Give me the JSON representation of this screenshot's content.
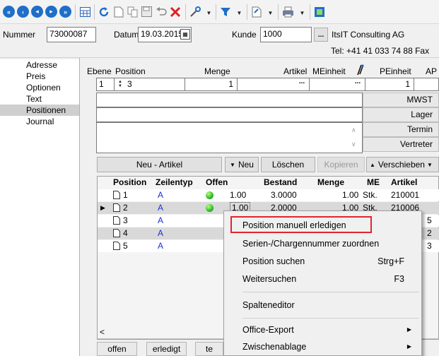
{
  "header": {
    "nummer_label": "Nummer",
    "nummer_value": "73000087",
    "datum_label": "Datum",
    "datum_value": "19.03.2015",
    "kunde_label": "Kunde",
    "kunde_value": "1000",
    "kunde_button": "...",
    "customer_name": "ItsIT Consulting AG",
    "tel": "Tel: +41 41 033 74 88  Fax"
  },
  "sidebar": {
    "items": [
      {
        "label": "Adresse"
      },
      {
        "label": "Preis"
      },
      {
        "label": "Optionen"
      },
      {
        "label": "Text"
      },
      {
        "label": "Positionen"
      },
      {
        "label": "Journal"
      }
    ]
  },
  "form": {
    "col_ebene": "Ebene",
    "col_position": "Position",
    "col_menge": "Menge",
    "col_artikel": "Artikel",
    "col_meinheit": "MEinheit",
    "col_peinheit": "PEinheit",
    "col_ap": "AP",
    "ebene_value": "1",
    "position_value": "3",
    "menge_value": "1",
    "peinheit_value": "1",
    "dots": "..."
  },
  "right_labels": [
    "MWST",
    "Lager",
    "Termin",
    "Vertreter"
  ],
  "actions": {
    "neu_artikel": "Neu - Artikel",
    "neu": "Neu",
    "loeschen": "Löschen",
    "kopieren": "Kopieren",
    "verschieben": "Verschieben"
  },
  "grid": {
    "columns": [
      "Position",
      "Zeilentyp",
      "Offen",
      "Bestand",
      "Menge",
      "ME",
      "Artikel"
    ],
    "rows": [
      {
        "position": "1",
        "typ": "A",
        "offen": "1.00",
        "bestand": "3.0000",
        "menge": "1.00",
        "me": "Stk.",
        "artikel": "210001"
      },
      {
        "position": "2",
        "typ": "A",
        "offen": "1.00",
        "bestand": "2.0000",
        "menge": "1.00",
        "me": "Stk.",
        "artikel": "210006"
      },
      {
        "position": "3",
        "typ": "A",
        "artikel": "5"
      },
      {
        "position": "4",
        "typ": "A",
        "artikel": "2"
      },
      {
        "position": "5",
        "typ": "A",
        "artikel": "3"
      }
    ],
    "scroll_left": "<"
  },
  "bottom_tabs": [
    "offen",
    "erledigt",
    "te"
  ],
  "context_menu": {
    "items": [
      {
        "label": "Position manuell erledigen",
        "shortcut": ""
      },
      {
        "label": "Serien-/Chargennummer zuordnen",
        "shortcut": ""
      },
      {
        "label": "Position suchen",
        "shortcut": "Strg+F"
      },
      {
        "label": "Weitersuchen",
        "shortcut": "F3"
      },
      {
        "label": "Spalteneditor",
        "shortcut": ""
      },
      {
        "label": "Office-Export",
        "shortcut": ""
      },
      {
        "label": "Zwischenablage",
        "shortcut": ""
      }
    ]
  }
}
